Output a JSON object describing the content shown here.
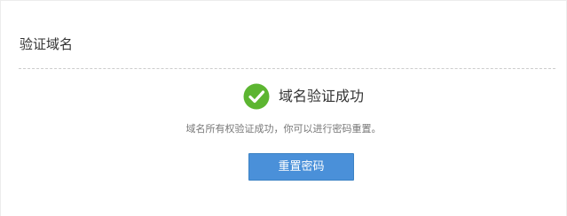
{
  "header": {
    "title": "验证域名"
  },
  "result": {
    "icon": "check-circle-icon",
    "icon_color": "#5cb531",
    "title": "域名验证成功",
    "message": "域名所有权验证成功，你可以进行密码重置。"
  },
  "actions": {
    "reset_label": "重置密码",
    "button_color": "#4a90d9"
  }
}
